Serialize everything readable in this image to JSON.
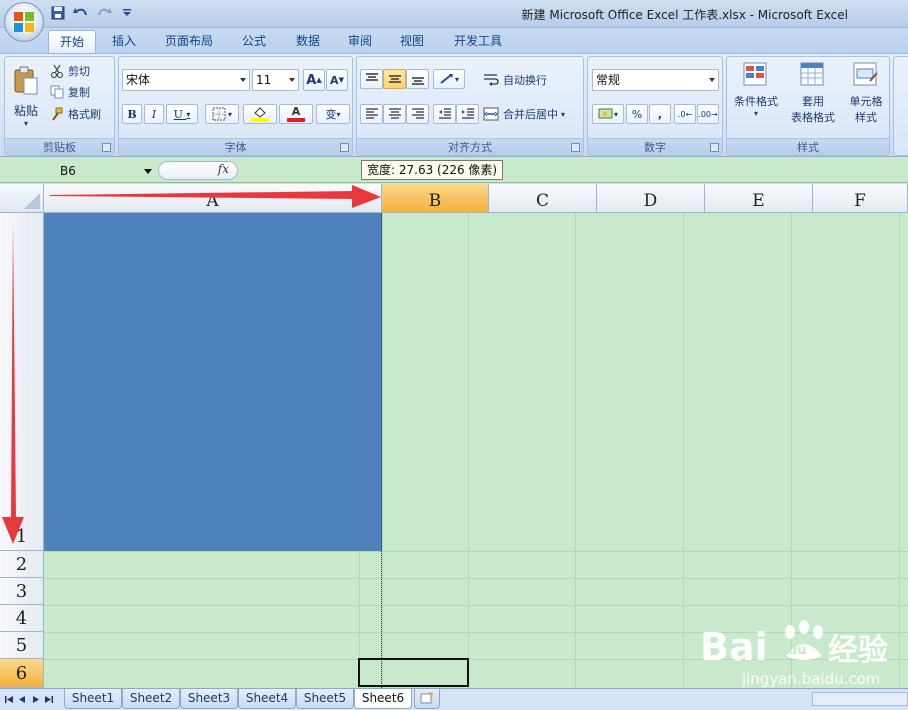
{
  "window": {
    "title": "新建 Microsoft Office Excel 工作表.xlsx - Microsoft Excel"
  },
  "ribbon": {
    "tabs": [
      "开始",
      "插入",
      "页面布局",
      "公式",
      "数据",
      "审阅",
      "视图",
      "开发工具"
    ],
    "active_tab": "开始",
    "clipboard": {
      "paste": "粘贴",
      "cut": "剪切",
      "copy": "复制",
      "format_painter": "格式刷",
      "label": "剪贴板"
    },
    "font": {
      "name": "宋体",
      "size": "11",
      "label": "字体"
    },
    "alignment": {
      "wrap_text": "自动换行",
      "merge_center": "合并后居中",
      "label": "对齐方式"
    },
    "number": {
      "format": "常规",
      "percent": "%",
      "comma": ",",
      "label": "数字"
    },
    "styles": {
      "conditional_format": "条件格式",
      "table_format_1": "套用",
      "table_format_2": "表格格式",
      "cell_styles_1": "单元格",
      "cell_styles_2": "样式",
      "label": "样式"
    }
  },
  "formula_bar": {
    "name_box": "B6",
    "fx": "fx"
  },
  "tooltip": "宽度: 27.63 (226 像素)",
  "columns": [
    "A",
    "B",
    "C",
    "D",
    "E",
    "F"
  ],
  "rows": [
    "1",
    "2",
    "3",
    "4",
    "5",
    "6"
  ],
  "selected_column": "B",
  "selected_row": "6",
  "sheets": [
    "Sheet1",
    "Sheet2",
    "Sheet3",
    "Sheet4",
    "Sheet5",
    "Sheet6"
  ],
  "active_sheet": "Sheet6",
  "colors": {
    "cell_fill": "#4f81bd",
    "grid_bg": "#c8e9cc",
    "arrow": "#e8383d",
    "header_highlight": "#f5b13d"
  },
  "watermark": {
    "text": "Bai经验",
    "url": "jingyan.baidu.com"
  }
}
